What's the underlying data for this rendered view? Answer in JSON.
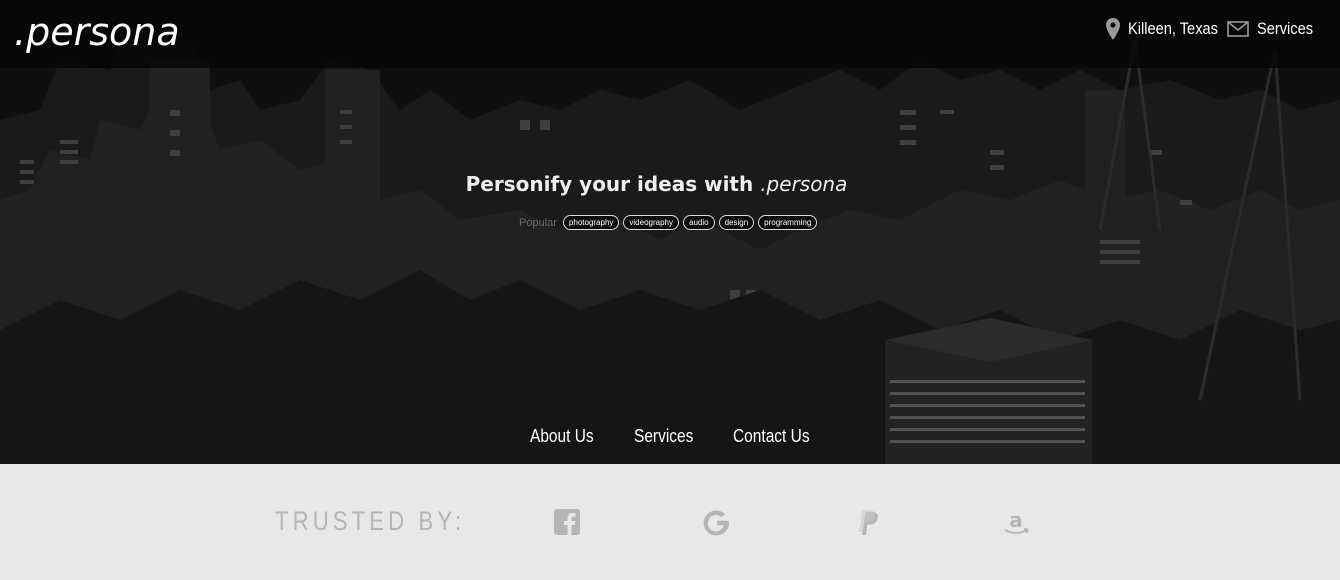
{
  "brand": {
    "logo_text": ".persona"
  },
  "topnav": {
    "location": {
      "label": "Killeen, Texas",
      "icon": "map-pin-icon"
    },
    "services": {
      "label": "Services",
      "icon": "mail-icon"
    }
  },
  "hero": {
    "headline_prefix": "Personify your ideas with ",
    "headline_brand": ".persona",
    "popular_label": "Popular",
    "tags": [
      "photography",
      "videography",
      "audio",
      "design",
      "programming"
    ]
  },
  "bottomnav": {
    "about": "About Us",
    "services": "Services",
    "contact": "Contact Us"
  },
  "trusted": {
    "label": "TRUSTED BY:",
    "logos": [
      "facebook-icon",
      "google-icon",
      "paypal-icon",
      "amazon-icon"
    ]
  },
  "colors": {
    "hero_bg": "#141414",
    "topbar_bg": "#060608",
    "footer_bg": "#e8e8e8",
    "muted_text": "#b5b5b5",
    "white": "#ffffff"
  }
}
